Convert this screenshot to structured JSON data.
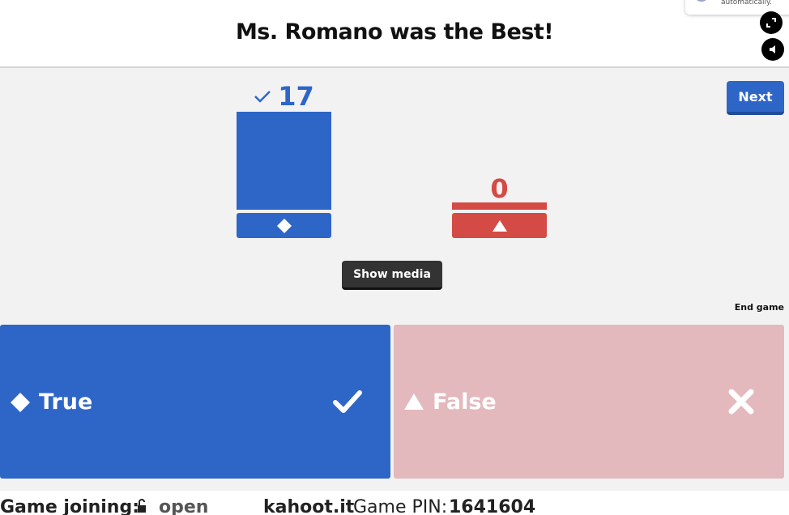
{
  "header": {
    "title": "Ms. Romano was the Best!",
    "toast_text": "automatically."
  },
  "controls": {
    "next_label": "Next",
    "show_media_label": "Show media",
    "end_game_label": "End game"
  },
  "results": [
    {
      "answer": "True",
      "shape": "diamond-icon",
      "count": "17",
      "correct": true,
      "color": "#2e66c8"
    },
    {
      "answer": "False",
      "shape": "triangle-icon",
      "count": "0",
      "correct": false,
      "color": "#d44a45"
    }
  ],
  "answers": [
    {
      "label": "True",
      "shape": "diamond-icon",
      "status": "correct",
      "color": "#2e66c8"
    },
    {
      "label": "False",
      "shape": "triangle-icon",
      "status": "incorrect",
      "color": "#e3b9bd"
    }
  ],
  "footer": {
    "joining_label": "Game joining:",
    "joining_status": "open",
    "site": "kahoot.it",
    "pin_label": "Game PIN:",
    "pin": "1641604"
  }
}
